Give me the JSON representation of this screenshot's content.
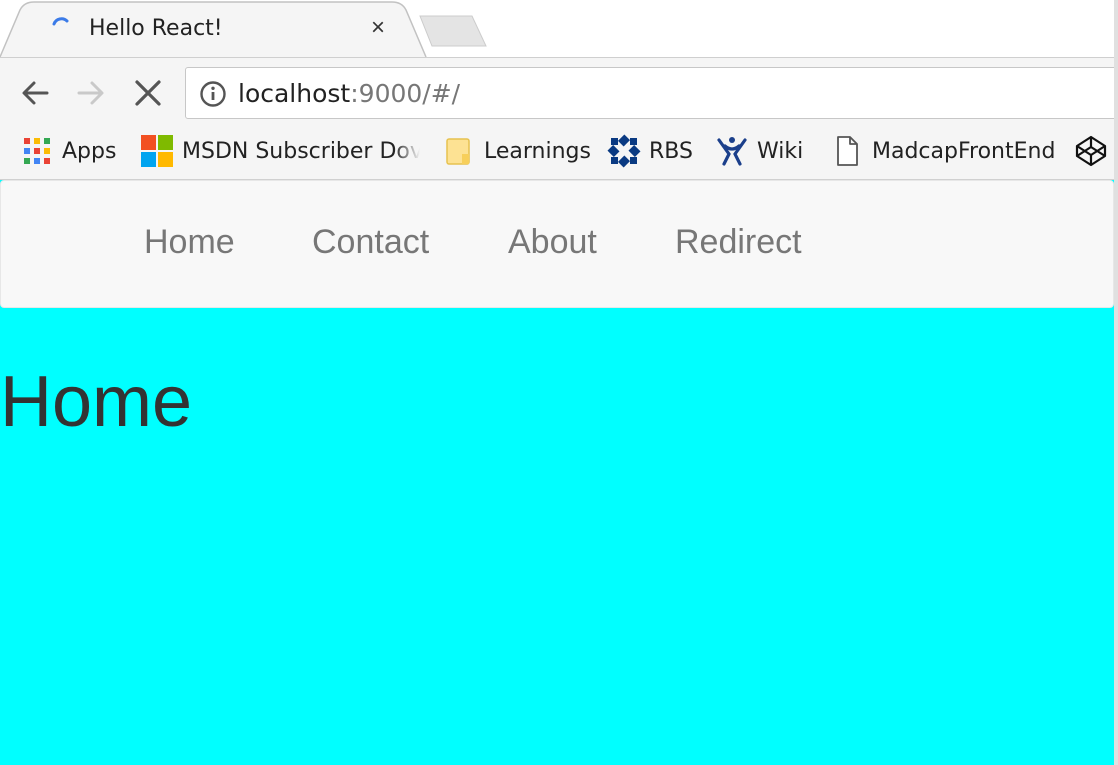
{
  "tab": {
    "title": "Hello React!",
    "close_label": "×",
    "loading_icon": "spinner-icon"
  },
  "toolbar": {
    "back_icon": "arrow-left-icon",
    "forward_icon": "arrow-right-icon",
    "stop_icon": "close-icon",
    "url_host": "localhost",
    "url_rest": ":9000/#/",
    "info_icon": "info-icon"
  },
  "bookmarks": [
    {
      "label": "Apps",
      "icon": "apps-grid-icon"
    },
    {
      "label": "MSDN Subscriber Dov",
      "icon": "microsoft-logo-icon"
    },
    {
      "label": "Learnings",
      "icon": "folder-icon"
    },
    {
      "label": "RBS",
      "icon": "rbs-logo-icon"
    },
    {
      "label": "Wiki",
      "icon": "wiki-logo-icon"
    },
    {
      "label": "MadcapFrontEnd",
      "icon": "page-icon"
    },
    {
      "label": "",
      "icon": "codepen-icon"
    }
  ],
  "navbar": {
    "links": [
      "Home",
      "Contact",
      "About",
      "Redirect"
    ]
  },
  "page": {
    "heading": "Home",
    "background": "#00ffff"
  }
}
